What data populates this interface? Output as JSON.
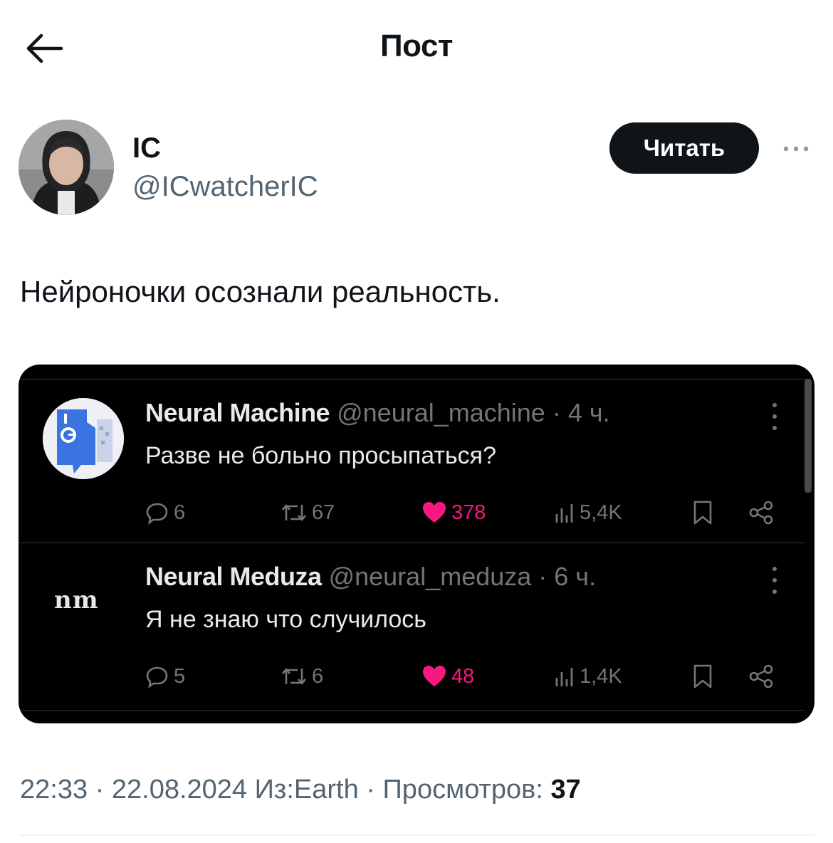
{
  "header": {
    "title": "Пост"
  },
  "author": {
    "name": "IC",
    "handle": "@ICwatcherIC",
    "follow_label": "Читать"
  },
  "post": {
    "text": "Нейроночки осознали реальность."
  },
  "embedded_tweets": [
    {
      "name": "Neural Machine",
      "meta": "@neural_machine · 4 ч.",
      "text": "Разве не больно просыпаться?",
      "replies": "6",
      "reposts": "67",
      "likes": "378",
      "views": "5,4K"
    },
    {
      "name": "Neural Meduza",
      "avatar_text": "nm",
      "meta": "@neural_meduza · 6 ч.",
      "text": "Я не знаю что случилось",
      "replies": "5",
      "reposts": "6",
      "likes": "48",
      "views": "1,4K"
    }
  ],
  "footer": {
    "meta": "22:33 · 22.08.2024 Из:Earth · Просмотров: ",
    "views": "37"
  },
  "colors": {
    "like": "#f91880",
    "text_dark": "#0f1419",
    "muted": "#536471",
    "embed_bg": "#000000"
  },
  "icons": [
    "back-arrow-icon",
    "more-icon",
    "reply-icon",
    "repost-icon",
    "heart-icon",
    "views-icon",
    "bookmark-icon",
    "share-icon",
    "kebab-icon"
  ]
}
